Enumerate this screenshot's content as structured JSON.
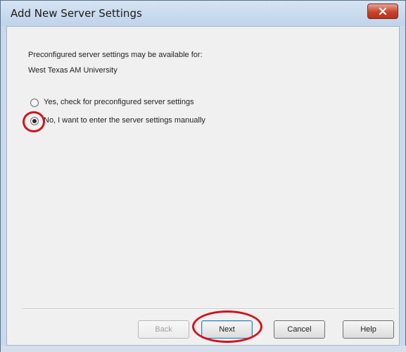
{
  "window": {
    "title": "Add New Server Settings"
  },
  "content": {
    "intro_line1": "Preconfigured server settings may be available for:",
    "intro_line2": "West Texas AM University",
    "option_yes": {
      "label": "Yes, check for preconfigured server settings",
      "selected": false
    },
    "option_no": {
      "label": "No, I want to enter the server settings manually",
      "selected": true
    }
  },
  "buttons": {
    "back": "Back",
    "next": "Next",
    "cancel": "Cancel",
    "help": "Help"
  },
  "icons": {
    "close": "close-icon"
  },
  "colors": {
    "annotation_red": "#d1141b",
    "close_button": "#c7432a"
  }
}
